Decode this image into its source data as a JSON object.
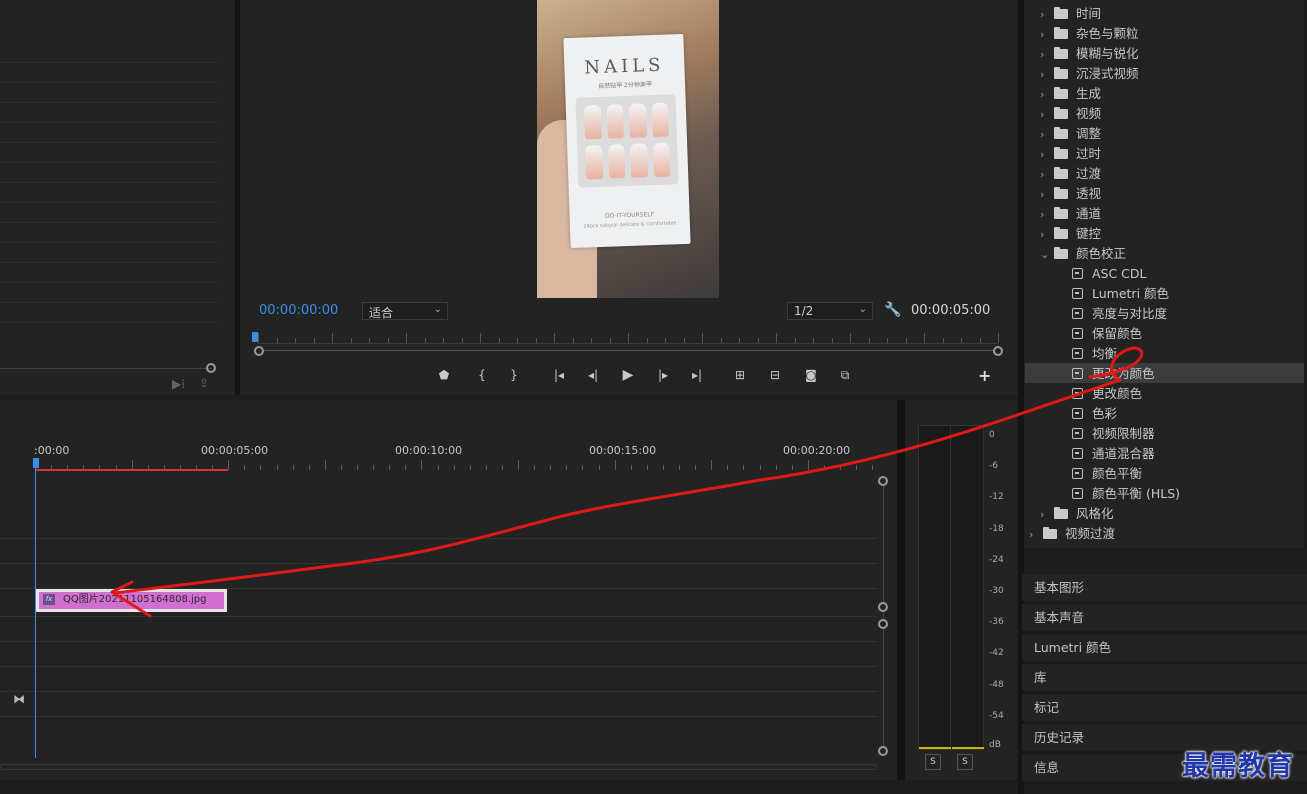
{
  "monitor": {
    "current_timecode": "00:00:00:00",
    "fit_select": "适合",
    "resolution_select": "1/2",
    "duration_timecode": "00:00:05:00",
    "video": {
      "box_title": "NAILS",
      "box_subtitle": "自然贴甲 2分钟美甲",
      "box_foot": "DO-IT-YOURSELF",
      "box_foot2": "24pcs natural delicate & comfortable"
    },
    "transport_icons": [
      "marker-icon",
      "mark-in-icon",
      "mark-out-icon",
      "go-to-in-icon",
      "step-back-icon",
      "play-icon",
      "step-forward-icon",
      "go-to-out-icon",
      "lift-icon",
      "extract-icon",
      "export-frame-icon",
      "compare-icon"
    ],
    "add_button": "+"
  },
  "effects": {
    "folders": [
      "时间",
      "杂色与颗粒",
      "模糊与锐化",
      "沉浸式视频",
      "生成",
      "视频",
      "调整",
      "过时",
      "过渡",
      "透视",
      "通道",
      "键控"
    ],
    "expanded_folder": "颜色校正",
    "color_correction_items": [
      "ASC CDL",
      "Lumetri 颜色",
      "亮度与对比度",
      "保留颜色",
      "均衡",
      "更改为颜色",
      "更改颜色",
      "色彩",
      "视频限制器",
      "通道混合器",
      "颜色平衡",
      "颜色平衡 (HLS)"
    ],
    "selected_item": "更改为颜色",
    "after_folder": "风格化",
    "root_folder": "视频过渡"
  },
  "collapsed_panels": [
    "基本图形",
    "基本声音",
    "Lumetri 颜色",
    "库",
    "标记",
    "历史记录",
    "信息"
  ],
  "timeline": {
    "ruler_labels": [
      ":00:00",
      "00:00:05:00",
      "00:00:10:00",
      "00:00:15:00",
      "00:00:20:00"
    ],
    "clip_name": "QQ图片20211105164808.jpg",
    "clip_fx_badge": "fx"
  },
  "audio_meter": {
    "db_scale": [
      "0",
      "-6",
      "-12",
      "-18",
      "-24",
      "-30",
      "-36",
      "-42",
      "-48",
      "-54",
      "dB"
    ],
    "solo_labels": [
      "S",
      "S"
    ]
  },
  "watermark": "最需教育",
  "colors": {
    "accent_blue": "#3a8ee6",
    "clip_color": "#d06fd0",
    "work_area_red": "#d23a3a",
    "annotation_red": "#e01818",
    "watermark_blue": "#2338a8"
  }
}
